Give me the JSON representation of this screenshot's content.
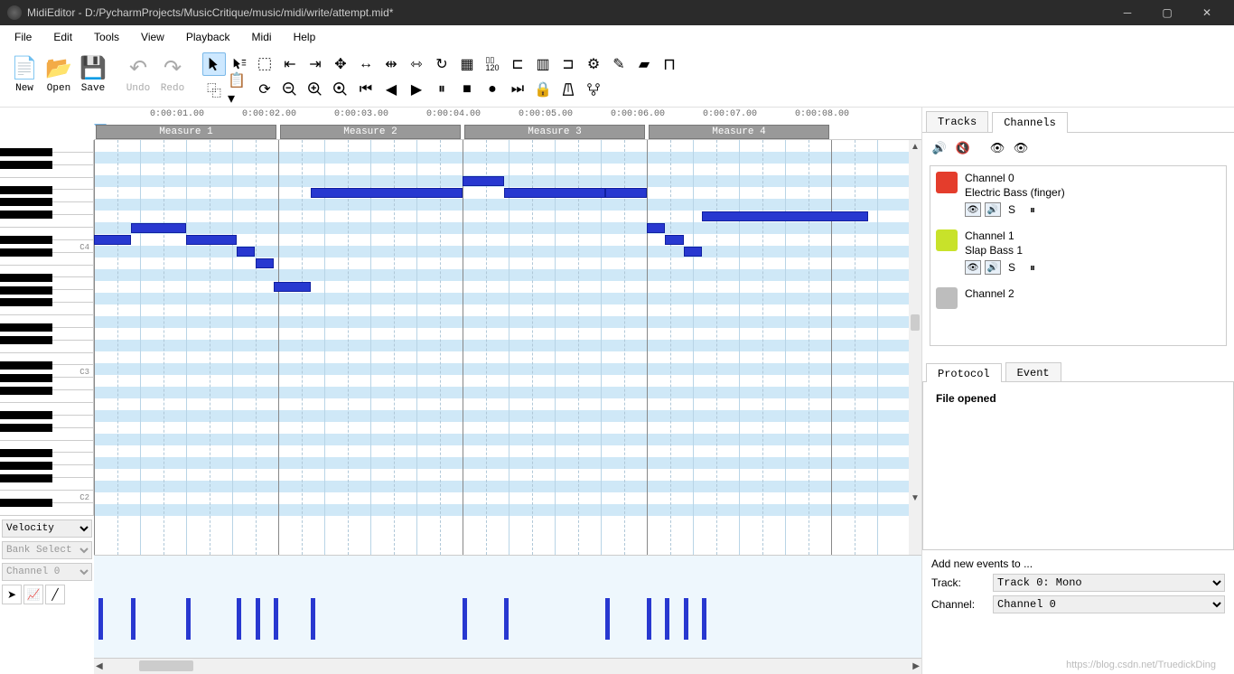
{
  "window": {
    "title": "MidiEditor - D:/PycharmProjects/MusicCritique/music/midi/write/attempt.mid*"
  },
  "menu": [
    "File",
    "Edit",
    "Tools",
    "View",
    "Playback",
    "Midi",
    "Help"
  ],
  "toolbar_main": [
    {
      "label": "New"
    },
    {
      "label": "Open"
    },
    {
      "label": "Save"
    },
    {
      "label": "Undo"
    },
    {
      "label": "Redo"
    }
  ],
  "ruler_times": [
    "0:00:01.00",
    "0:00:02.00",
    "0:00:03.00",
    "0:00:04.00",
    "0:00:05.00",
    "0:00:06.00",
    "0:00:07.00",
    "0:00:08.00"
  ],
  "measures": [
    "Measure 1",
    "Measure 2",
    "Measure 3",
    "Measure 4"
  ],
  "piano_labels": [
    {
      "row": 8,
      "text": "C4"
    },
    {
      "row": 18,
      "text": "C3"
    },
    {
      "row": 28,
      "text": "C2"
    }
  ],
  "notes": [
    {
      "start": 0.0,
      "len": 0.4,
      "row": 8
    },
    {
      "start": 0.4,
      "len": 0.6,
      "row": 7
    },
    {
      "start": 1.0,
      "len": 0.55,
      "row": 8
    },
    {
      "start": 1.55,
      "len": 0.2,
      "row": 9
    },
    {
      "start": 1.75,
      "len": 0.2,
      "row": 10
    },
    {
      "start": 1.95,
      "len": 0.4,
      "row": 12
    },
    {
      "start": 2.35,
      "len": 1.65,
      "row": 4
    },
    {
      "start": 4.0,
      "len": 0.45,
      "row": 3
    },
    {
      "start": 4.45,
      "len": 1.1,
      "row": 4
    },
    {
      "start": 5.55,
      "len": 0.45,
      "row": 4
    },
    {
      "start": 6.0,
      "len": 0.2,
      "row": 7
    },
    {
      "start": 6.2,
      "len": 0.2,
      "row": 8
    },
    {
      "start": 6.4,
      "len": 0.2,
      "row": 9
    },
    {
      "start": 6.6,
      "len": 1.8,
      "row": 6
    }
  ],
  "velocity_x": [
    0.05,
    0.4,
    1.0,
    1.55,
    1.75,
    1.95,
    2.35,
    4.0,
    4.45,
    5.55,
    6.0,
    6.2,
    6.4,
    6.6
  ],
  "leftcontrols": {
    "property": "Velocity",
    "bank": "Bank Select",
    "channel": "Channel 0"
  },
  "right": {
    "tabs": [
      "Tracks",
      "Channels"
    ],
    "channels": [
      {
        "name": "Channel 0",
        "instrument": "Electric Bass (finger)",
        "color": "#e43d2c"
      },
      {
        "name": "Channel 1",
        "instrument": "Slap Bass 1",
        "color": "#c8e22a"
      },
      {
        "name": "Channel 2",
        "instrument": "",
        "color": "#bdbdbd"
      }
    ],
    "ch_ctrl_s": "S",
    "proto_tabs": [
      "Protocol",
      "Event"
    ],
    "proto_text": "File opened",
    "form_title": "Add new events to ...",
    "track_label": "Track:",
    "track_value": "Track 0: Mono",
    "channel_label": "Channel:",
    "channel_value": "Channel 0"
  },
  "watermark": "https://blog.csdn.net/TruedickDing"
}
